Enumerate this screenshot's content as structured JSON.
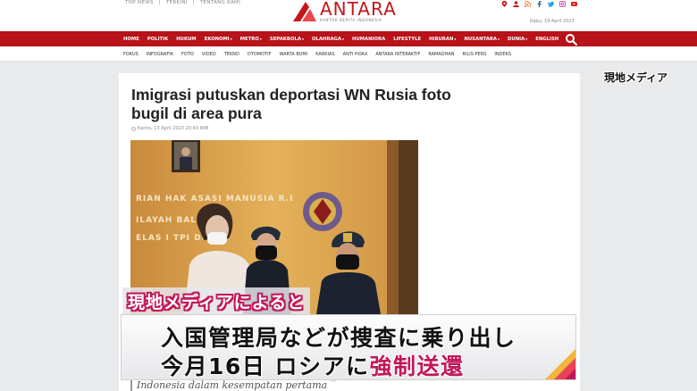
{
  "header": {
    "top_links": [
      "TOP NEWS",
      "|",
      "TERKINI",
      "|",
      "TENTANG KAMI"
    ],
    "logo_word": "ANTARA",
    "logo_tagline": "KANTOR BERITA INDONESIA",
    "date": "Rabu, 19 April 2023",
    "social_icons": [
      "location-icon",
      "user-icon",
      "rss-icon",
      "facebook-icon",
      "twitter-icon",
      "instagram-icon",
      "youtube-icon"
    ]
  },
  "nav": {
    "items": [
      {
        "label": "HOME",
        "caret": false
      },
      {
        "label": "POLITIK",
        "caret": false
      },
      {
        "label": "HUKUM",
        "caret": false
      },
      {
        "label": "EKONOMI",
        "caret": true
      },
      {
        "label": "METRO",
        "caret": true
      },
      {
        "label": "SEPAKBOLA",
        "caret": true
      },
      {
        "label": "OLAHRAGA",
        "caret": true
      },
      {
        "label": "HUMANIORA",
        "caret": false
      },
      {
        "label": "LIFESTYLE",
        "caret": false
      },
      {
        "label": "HIBURAN",
        "caret": true
      },
      {
        "label": "NUSANTARA",
        "caret": true
      },
      {
        "label": "DUNIA",
        "caret": true
      },
      {
        "label": "ENGLISH",
        "caret": false
      }
    ]
  },
  "subnav": {
    "items": [
      "FOKUS",
      "INFOGRAFIK",
      "FOTO",
      "VIDEO",
      "TEKNO",
      "OTOMOTIF",
      "WARTA BUMI",
      "KARKIAS",
      "ANTI HOAX",
      "ANTARA INTERAKTIF",
      "RAMADHAN",
      "RILIS PERS",
      "INDEKS"
    ]
  },
  "article": {
    "headline": "Imigrasi putuskan deportasi WN Rusia foto bugil di area pura",
    "byline": "Kamis, 13 April 2023 20:43 WIB",
    "photo_sign_line1": "RIAN HAK ASASI MANUSIA R.I",
    "photo_sign_line2": "ILAYAH BALI",
    "photo_sign_line3": "ELAS I TPI DE",
    "quote_text": "Indonesia dalam kesempatan pertama",
    "quote_mark": "”"
  },
  "overlay": {
    "watermark": "現地メディア",
    "caption_small": "現地メディアによると",
    "caption_line1": "入国管理局などが捜査に乗り出し",
    "caption_line2_prefix": "今月16日 ロシアに",
    "caption_line2_accent": "強制送還"
  },
  "colors": {
    "brand_red": "#b8121a",
    "caption_accent": "#c2185b",
    "page_bg": "#e9eaec"
  }
}
